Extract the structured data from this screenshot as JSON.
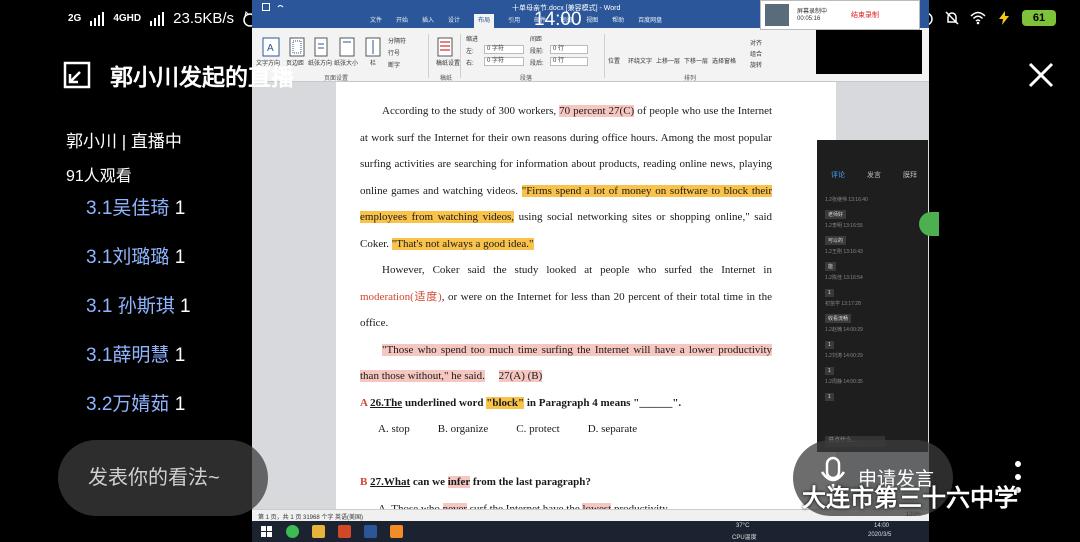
{
  "status_bar": {
    "signal1": "2G",
    "signal2": "4GHD",
    "speed": "23.5KB/s",
    "battery": "61"
  },
  "live": {
    "title": "郭小川发起的直播",
    "host": "郭小川 | 直播中",
    "viewers": "91人观看",
    "comments": [
      {
        "name": "3.1吴佳琦",
        "count": "1"
      },
      {
        "name": "3.1刘璐璐",
        "count": "1"
      },
      {
        "name": "3.1 孙斯琪",
        "count": "1"
      },
      {
        "name": "3.1薛明慧",
        "count": "1"
      },
      {
        "name": "3.2万婧茹",
        "count": "1"
      }
    ],
    "comment_placeholder": "发表你的看法~",
    "apply_label": "申请发言",
    "watermark": "大连市第三十六中学"
  },
  "word": {
    "clock": "14:00",
    "doc_title": "十单母亲节.docx [兼容模式] - Word",
    "tabs": [
      "文件",
      "开始",
      "插入",
      "设计",
      "布局",
      "引用",
      "邮件",
      "审阅",
      "视图",
      "帮助",
      "百度网盘"
    ],
    "active_tab": "布局",
    "ribbon": {
      "btn_text_dir": "文字方向",
      "btn_margins": "页边距",
      "btn_orientation": "纸张方向",
      "btn_size": "纸张大小",
      "btn_columns": "栏",
      "opt_breaks": "分隔符",
      "opt_line_numbers": "行号",
      "opt_hyphenation": "断字",
      "group_page_setup": "页面设置",
      "btn_paper": "稿纸设置",
      "group_paper": "稿纸",
      "indent_label": "缩进",
      "spacing_label": "间距",
      "left_label": "左:",
      "right_label": "右:",
      "before_label": "段前:",
      "after_label": "段后:",
      "indent_left": "0 字符",
      "indent_right": "0 字符",
      "space_before": "0 行",
      "space_after": "0 行",
      "group_paragraph": "段落",
      "btn_position": "位置",
      "btn_wrap": "环绕文字",
      "btn_forward": "上移一层",
      "btn_backward": "下移一层",
      "btn_select_pane": "选择窗格",
      "opt_align": "对齐",
      "opt_group": "组合",
      "opt_rotate": "旋转",
      "group_arrange": "排列"
    },
    "recorder": {
      "line1": "屏幕录制中",
      "line2": "00:05:16",
      "stop": "结束录制"
    },
    "document": {
      "p1_a": "According to the study of 300 workers, ",
      "p1_hl1": "70 percent 27(C)",
      "p1_b": " of people who use the Internet at work surf the Internet for their own reasons during office hours. Among the most popular surfing activities are searching for information about products, reading online news, playing online games and watching videos. ",
      "p1_hl2": "\"Firms spend a lot of money on software to block their employees from watching videos,",
      "p1_c": " using social networking sites or shopping online,\" said Coker. ",
      "p1_hl3": "\"That's not always a good idea.\"",
      "p2_a": "However, Coker said the study looked at people who surfed the Internet in ",
      "p2_red": "moderation(适度)",
      "p2_b": ", or were on the Internet for less than 20 percent of their total time in the office.",
      "p3_hl": "\"Those who spend too much time surfing the Internet will have a lower productivity than those without,\" he said.",
      "p3_mark": "27(A) (B)",
      "q26_letter": "A",
      "q26_num": "26.The",
      "q26_a": " underlined word ",
      "q26_word": "\"block\"",
      "q26_b": " in Paragraph 4 means \"______\".",
      "opt_a": "A. stop",
      "opt_b": "B. organize",
      "opt_c": "C. protect",
      "opt_d": "D. separate",
      "q27_letter": "B",
      "q27_num": "27.What",
      "q27_a": " can we ",
      "q27_infer": "infer",
      "q27_b": " from the last paragraph?",
      "q27_opt_a1": "A. Those who ",
      "q27_never": "never",
      "q27_opt_a2": " surf the Internet have the ",
      "q27_lowest": "lowest",
      "q27_opt_a3": " productivity."
    },
    "status_left": "第 1 页，共 1 页  31968 个字  英语(美国)",
    "status_right": "120%"
  },
  "side_panel": {
    "tabs": [
      "评论",
      "发言",
      "膜拜"
    ],
    "messages": [
      {
        "who": "1.2张继伟 13:16:40",
        "text": "老师好"
      },
      {
        "who": "1.2李明 13:16:55",
        "text": "可以的"
      },
      {
        "who": "1.2王刚 13:16:43",
        "text": "能"
      },
      {
        "who": "1.2陈佳 13:16:54",
        "text": "1"
      },
      {
        "who": "初苗学 13:17:28",
        "text": "收看流畅"
      },
      {
        "who": "1.2赵楠 14:00:29",
        "text": "1"
      },
      {
        "who": "1.2刘涛 14:00:29",
        "text": "1"
      },
      {
        "who": "1.2周静 14:00:35",
        "text": "1"
      }
    ],
    "input": "说点什么..."
  },
  "taskbar": {
    "temp": "37°C",
    "cpu": "CPU温度",
    "time": "14:00",
    "date": "2020/3/5"
  }
}
